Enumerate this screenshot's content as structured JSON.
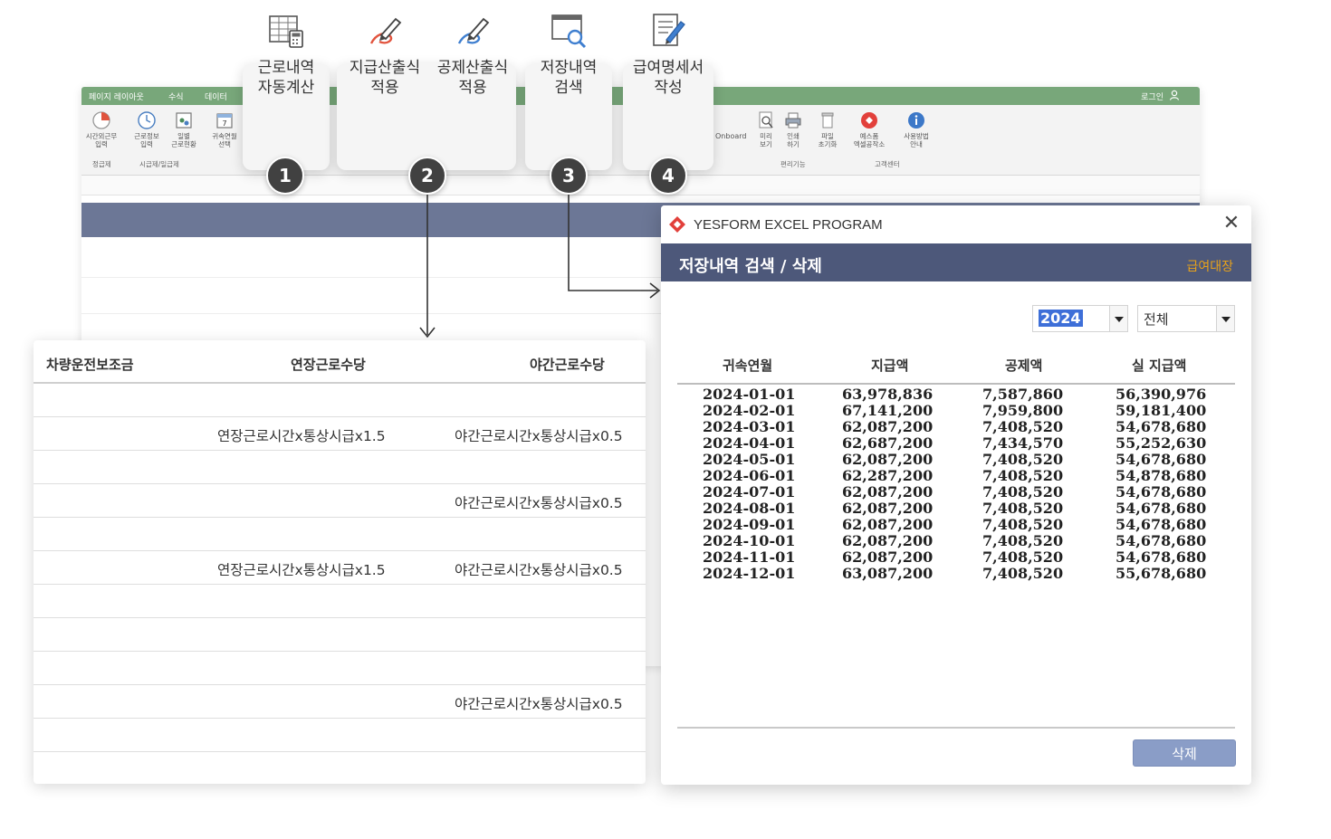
{
  "excel": {
    "menu_tabs": [
      "페이지 레이아웃",
      "수식",
      "데이터"
    ],
    "login": "로그인",
    "ribbon_buttons": [
      {
        "label1": "시간외근무",
        "label2": "입력"
      },
      {
        "label1": "근로정보",
        "label2": "입력"
      },
      {
        "label1": "일별",
        "label2": "근로현황"
      },
      {
        "label1": "귀속연월",
        "label2": "선택"
      },
      {
        "label1": "미리",
        "label2": "보기"
      },
      {
        "label1": "인쇄",
        "label2": "하기"
      },
      {
        "label1": "파일",
        "label2": "초기화"
      },
      {
        "label1": "예스폼",
        "label2": "엑셀공작소"
      },
      {
        "label1": "사용방법",
        "label2": "안내"
      }
    ],
    "ribbon_groups": [
      "정급제",
      "시급제/일급제",
      "편리기능",
      "고객센터"
    ],
    "onboard": "Onboard"
  },
  "features": [
    {
      "line1": "근로내역",
      "line2": "자동계산",
      "badge": "1",
      "icon": "calculator-sheet-icon"
    },
    {
      "line1": "지급산출식",
      "line2": "적용",
      "badge": "2",
      "icon": "pen-red-icon"
    },
    {
      "line1": "공제산출식",
      "line2": "적용",
      "icon": "pen-blue-icon"
    },
    {
      "line1": "저장내역",
      "line2": "검색",
      "badge": "3",
      "icon": "search-window-icon"
    },
    {
      "line1": "급여명세서",
      "line2": "작성",
      "badge": "4",
      "icon": "document-edit-icon"
    }
  ],
  "left_table": {
    "headers": [
      "차량운전보조금",
      "연장근로수당",
      "야간근로수당"
    ],
    "rows": [
      {
        "c2": "",
        "c3": ""
      },
      {
        "c2": "연장근로시간x통상시급x1.5",
        "c3": "야간근로시간x통상시급x0.5"
      },
      {
        "c2": "",
        "c3": ""
      },
      {
        "c2": "",
        "c3": "야간근로시간x통상시급x0.5"
      },
      {
        "c2": "",
        "c3": ""
      },
      {
        "c2": "연장근로시간x통상시급x1.5",
        "c3": "야간근로시간x통상시급x0.5"
      },
      {
        "c2": "",
        "c3": ""
      },
      {
        "c2": "",
        "c3": ""
      },
      {
        "c2": "",
        "c3": ""
      },
      {
        "c2": "",
        "c3": "야간근로시간x통상시급x0.5"
      },
      {
        "c2": "",
        "c3": ""
      }
    ]
  },
  "dialog": {
    "window_title": "YESFORM EXCEL PROGRAM",
    "header_title": "저장내역 검색 / 삭제",
    "header_link": "급여대장",
    "year": "2024",
    "filter": "전체",
    "columns": [
      "귀속연월",
      "지급액",
      "공제액",
      "실 지급액"
    ],
    "rows": [
      {
        "month": "2024-01-01",
        "pay": "63,978,836",
        "deduct": "7,587,860",
        "net": "56,390,976"
      },
      {
        "month": "2024-02-01",
        "pay": "67,141,200",
        "deduct": "7,959,800",
        "net": "59,181,400"
      },
      {
        "month": "2024-03-01",
        "pay": "62,087,200",
        "deduct": "7,408,520",
        "net": "54,678,680"
      },
      {
        "month": "2024-04-01",
        "pay": "62,687,200",
        "deduct": "7,434,570",
        "net": "55,252,630"
      },
      {
        "month": "2024-05-01",
        "pay": "62,087,200",
        "deduct": "7,408,520",
        "net": "54,678,680"
      },
      {
        "month": "2024-06-01",
        "pay": "62,287,200",
        "deduct": "7,408,520",
        "net": "54,878,680"
      },
      {
        "month": "2024-07-01",
        "pay": "62,087,200",
        "deduct": "7,408,520",
        "net": "54,678,680"
      },
      {
        "month": "2024-08-01",
        "pay": "62,087,200",
        "deduct": "7,408,520",
        "net": "54,678,680"
      },
      {
        "month": "2024-09-01",
        "pay": "62,087,200",
        "deduct": "7,408,520",
        "net": "54,678,680"
      },
      {
        "month": "2024-10-01",
        "pay": "62,087,200",
        "deduct": "7,408,520",
        "net": "54,678,680"
      },
      {
        "month": "2024-11-01",
        "pay": "62,087,200",
        "deduct": "7,408,520",
        "net": "54,678,680"
      },
      {
        "month": "2024-12-01",
        "pay": "63,087,200",
        "deduct": "7,408,520",
        "net": "55,678,680"
      }
    ],
    "delete_label": "삭제"
  },
  "colors": {
    "excel_green": "#78a77a",
    "dialog_header": "#4d587a",
    "link_orange": "#e8a21a",
    "delete_button": "#8a9dc7",
    "badge": "#414141"
  }
}
